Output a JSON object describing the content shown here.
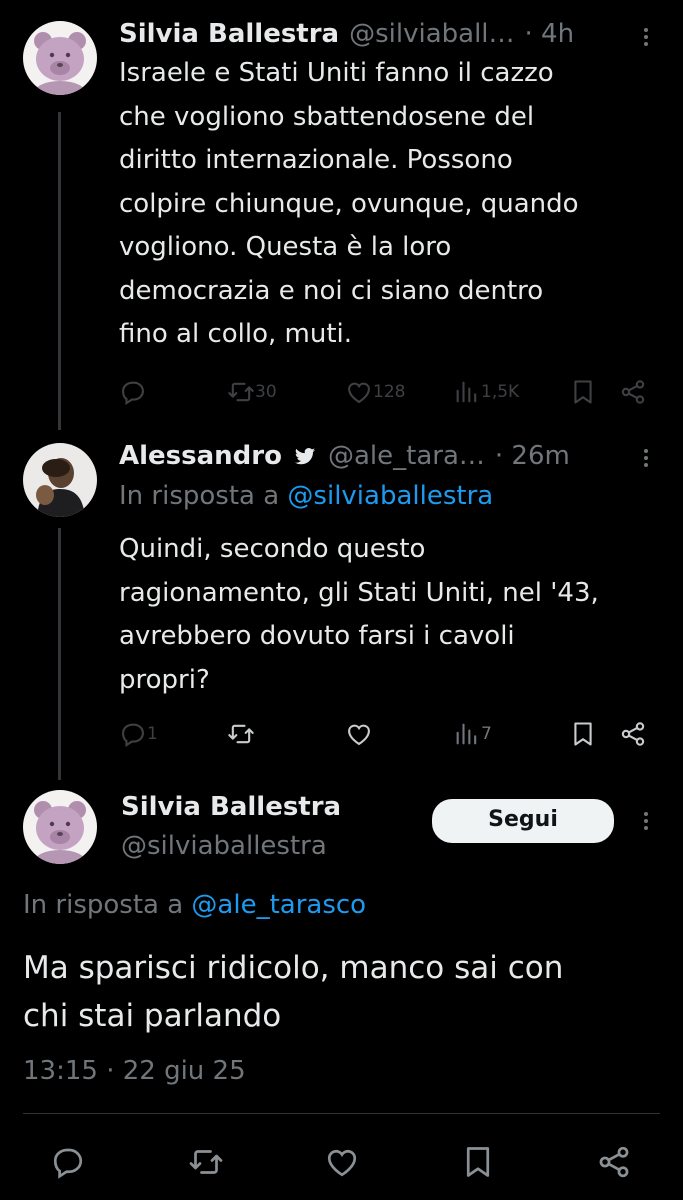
{
  "tweet1": {
    "name": "Silvia Ballestra",
    "handle": "@silviaball…",
    "time": "· 4h",
    "text_lines": [
      "Israele e Stati Uniti fanno il cazzo",
      "che vogliono sbattendosene del",
      "diritto internazionale. Possono",
      "colpire chiunque, ovunque, quando",
      "vogliono. Questa è la loro",
      "democrazia e noi ci siano dentro",
      "fino al collo, muti."
    ],
    "actions": {
      "replies": "",
      "retweets": "30",
      "likes": "128",
      "views": "1,5K"
    }
  },
  "tweet2": {
    "name": "Alessandro",
    "handle": "@ale_tara…",
    "time": "· 26m",
    "reply_prefix": "In risposta a ",
    "reply_to": "@silviaballestra",
    "text_lines": [
      "Quindi, secondo questo",
      "ragionamento, gli Stati Uniti, nel '43,",
      "avrebbero dovuto farsi i cavoli",
      "propri?"
    ],
    "actions": {
      "replies": "1",
      "retweets": "",
      "likes": "",
      "views": "7"
    }
  },
  "main_tweet": {
    "name": "Silvia Ballestra",
    "handle": "@silviaballestra",
    "follow_label": "Segui",
    "reply_prefix": "In risposta a ",
    "reply_to": "@ale_tarasco",
    "text_lines": [
      "Ma sparisci ridicolo, manco sai con",
      "chi stai parlando"
    ],
    "timestamp": "13:15 · 22 giu 25"
  },
  "colors": {
    "background": "#000000",
    "link": "#1d9bf0",
    "muted": "#71767b",
    "text": "#e7e9ea"
  }
}
